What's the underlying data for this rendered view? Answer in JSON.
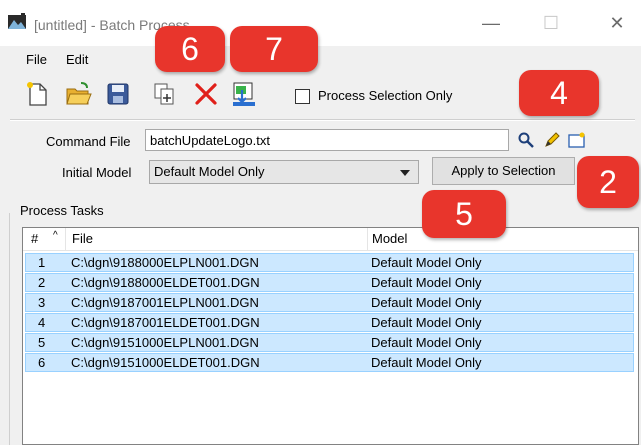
{
  "window": {
    "title": "[untitled] - Batch Process",
    "minimize": "—",
    "maximize": "☐",
    "close": "✕"
  },
  "menu": {
    "file": "File",
    "edit": "Edit"
  },
  "toolbar": {
    "new_icon": "new-file-icon",
    "open_icon": "open-folder-icon",
    "save_icon": "save-icon",
    "add_icon": "add-files-icon",
    "remove_icon": "remove-icon",
    "process_icon": "process-icon"
  },
  "process_selection_only": {
    "label": "Process Selection Only",
    "checked": false
  },
  "command_file": {
    "label": "Command File",
    "value": "batchUpdateLogo.txt"
  },
  "initial_model": {
    "label": "Initial Model",
    "value": "Default Model Only"
  },
  "apply_button": "Apply to Selection",
  "process_tasks": {
    "label": "Process Tasks",
    "columns": [
      "#",
      "File",
      "Model"
    ],
    "rows": [
      {
        "num": "1",
        "file": "C:\\dgn\\9188000ELPLN001.DGN",
        "model": "Default Model Only"
      },
      {
        "num": "2",
        "file": "C:\\dgn\\9188000ELDET001.DGN",
        "model": "Default Model Only"
      },
      {
        "num": "3",
        "file": "C:\\dgn\\9187001ELPLN001.DGN",
        "model": "Default Model Only"
      },
      {
        "num": "4",
        "file": "C:\\dgn\\9187001ELDET001.DGN",
        "model": "Default Model Only"
      },
      {
        "num": "5",
        "file": "C:\\dgn\\9151000ELPLN001.DGN",
        "model": "Default Model Only"
      },
      {
        "num": "6",
        "file": "C:\\dgn\\9151000ELDET001.DGN",
        "model": "Default Model Only"
      }
    ]
  },
  "callouts": {
    "c6": "6",
    "c7": "7",
    "c4": "4",
    "c2": "2",
    "c5": "5"
  },
  "colors": {
    "callout": "#e8352c",
    "row_selected": "#cce8ff"
  }
}
